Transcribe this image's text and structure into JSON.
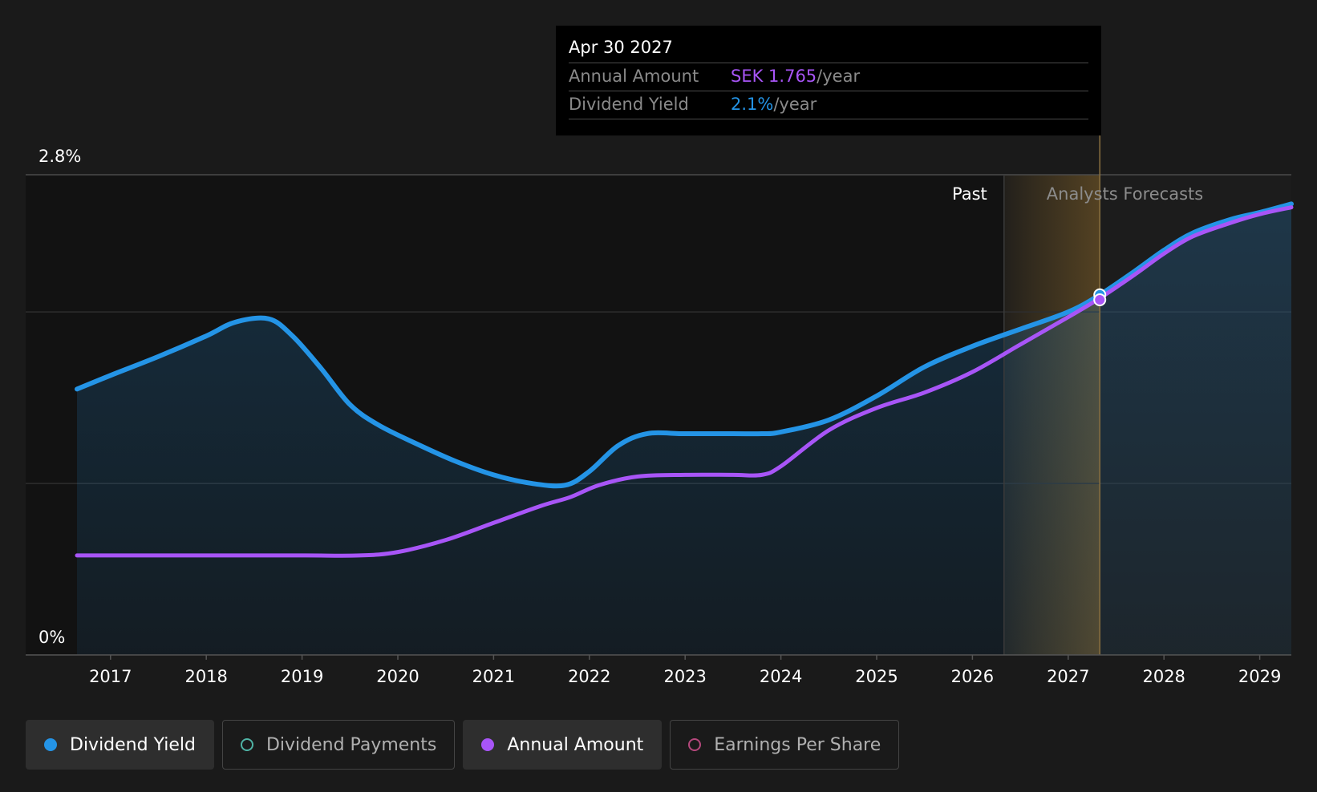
{
  "tooltip": {
    "date": "Apr 30 2027",
    "rows": [
      {
        "label": "Annual Amount",
        "value": "SEK 1.765",
        "unit": "/year"
      },
      {
        "label": "Dividend Yield",
        "value": "2.1%",
        "unit": "/year"
      }
    ]
  },
  "legend": [
    {
      "label": "Dividend Yield",
      "state": "active",
      "color": "#2494e6"
    },
    {
      "label": "Dividend Payments",
      "state": "inactive",
      "color": "#4fb3a5"
    },
    {
      "label": "Annual Amount",
      "state": "active",
      "color": "#a855f7"
    },
    {
      "label": "Earnings Per Share",
      "state": "inactive",
      "color": "#b5487c"
    }
  ],
  "chart_data": {
    "type": "line",
    "y_tick_labels": [
      "2.8%",
      "0%"
    ],
    "ylim": [
      0,
      2.8
    ],
    "xlim": [
      2016.65,
      2029.33
    ],
    "x_ticks": [
      "2017",
      "2018",
      "2019",
      "2020",
      "2021",
      "2022",
      "2023",
      "2024",
      "2025",
      "2026",
      "2027",
      "2028",
      "2029"
    ],
    "grid": true,
    "past_label": "Past",
    "forecast_label": "Analysts Forecasts",
    "forecast_start": 2026.33,
    "hover_x": 2027.33,
    "colors": {
      "yield": "#2494e6",
      "amount": "#a855f7",
      "forecast_band": "#e8a838"
    },
    "series": [
      {
        "name": "Dividend Yield",
        "unit": "%",
        "points": [
          [
            2016.65,
            1.55
          ],
          [
            2017.0,
            1.63
          ],
          [
            2017.5,
            1.74
          ],
          [
            2018.0,
            1.86
          ],
          [
            2018.3,
            1.94
          ],
          [
            2018.65,
            1.96
          ],
          [
            2018.9,
            1.86
          ],
          [
            2019.2,
            1.67
          ],
          [
            2019.5,
            1.46
          ],
          [
            2019.8,
            1.34
          ],
          [
            2020.2,
            1.23
          ],
          [
            2020.6,
            1.13
          ],
          [
            2021.0,
            1.05
          ],
          [
            2021.4,
            1.0
          ],
          [
            2021.75,
            0.99
          ],
          [
            2022.0,
            1.07
          ],
          [
            2022.3,
            1.22
          ],
          [
            2022.6,
            1.29
          ],
          [
            2023.0,
            1.29
          ],
          [
            2023.5,
            1.29
          ],
          [
            2023.8,
            1.29
          ],
          [
            2024.0,
            1.3
          ],
          [
            2024.5,
            1.37
          ],
          [
            2025.0,
            1.51
          ],
          [
            2025.5,
            1.68
          ],
          [
            2026.0,
            1.8
          ],
          [
            2026.5,
            1.9
          ],
          [
            2027.0,
            2.0
          ],
          [
            2027.33,
            2.1
          ],
          [
            2027.7,
            2.24
          ],
          [
            2028.0,
            2.36
          ],
          [
            2028.3,
            2.46
          ],
          [
            2028.7,
            2.54
          ],
          [
            2029.0,
            2.58
          ],
          [
            2029.33,
            2.63
          ]
        ]
      },
      {
        "name": "Annual Amount",
        "unit": "%",
        "points": [
          [
            2016.65,
            0.58
          ],
          [
            2017.0,
            0.58
          ],
          [
            2018.0,
            0.58
          ],
          [
            2019.0,
            0.58
          ],
          [
            2019.6,
            0.58
          ],
          [
            2020.0,
            0.6
          ],
          [
            2020.5,
            0.67
          ],
          [
            2021.0,
            0.77
          ],
          [
            2021.5,
            0.87
          ],
          [
            2021.8,
            0.92
          ],
          [
            2022.1,
            0.99
          ],
          [
            2022.5,
            1.04
          ],
          [
            2023.0,
            1.05
          ],
          [
            2023.5,
            1.05
          ],
          [
            2023.8,
            1.05
          ],
          [
            2024.0,
            1.1
          ],
          [
            2024.5,
            1.31
          ],
          [
            2025.0,
            1.44
          ],
          [
            2025.5,
            1.53
          ],
          [
            2026.0,
            1.65
          ],
          [
            2026.5,
            1.81
          ],
          [
            2027.0,
            1.97
          ],
          [
            2027.33,
            2.08
          ],
          [
            2027.7,
            2.22
          ],
          [
            2028.0,
            2.34
          ],
          [
            2028.3,
            2.44
          ],
          [
            2028.7,
            2.52
          ],
          [
            2029.0,
            2.57
          ],
          [
            2029.33,
            2.61
          ]
        ]
      }
    ]
  }
}
